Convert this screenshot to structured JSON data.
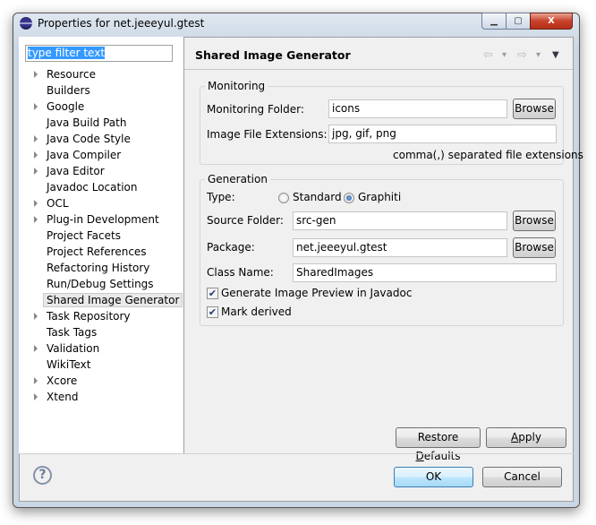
{
  "window": {
    "title": "Properties for net.jeeeyul.gtest",
    "minimize": "▁",
    "maximize": "▢",
    "close": "X"
  },
  "filter": {
    "value": "type filter text"
  },
  "tree": [
    {
      "label": "Resource",
      "expandable": true
    },
    {
      "label": "Builders",
      "expandable": false
    },
    {
      "label": "Google",
      "expandable": true
    },
    {
      "label": "Java Build Path",
      "expandable": false
    },
    {
      "label": "Java Code Style",
      "expandable": true
    },
    {
      "label": "Java Compiler",
      "expandable": true
    },
    {
      "label": "Java Editor",
      "expandable": true
    },
    {
      "label": "Javadoc Location",
      "expandable": false
    },
    {
      "label": "OCL",
      "expandable": true
    },
    {
      "label": "Plug-in Development",
      "expandable": true
    },
    {
      "label": "Project Facets",
      "expandable": false
    },
    {
      "label": "Project References",
      "expandable": false
    },
    {
      "label": "Refactoring History",
      "expandable": false
    },
    {
      "label": "Run/Debug Settings",
      "expandable": false
    },
    {
      "label": "Shared Image Generator",
      "expandable": false,
      "selected": true
    },
    {
      "label": "Task Repository",
      "expandable": true
    },
    {
      "label": "Task Tags",
      "expandable": false
    },
    {
      "label": "Validation",
      "expandable": true
    },
    {
      "label": "WikiText",
      "expandable": false
    },
    {
      "label": "Xcore",
      "expandable": true
    },
    {
      "label": "Xtend",
      "expandable": true
    }
  ],
  "page": {
    "title": "Shared Image Generator",
    "nav": {
      "back": "⇦",
      "forward": "⇨",
      "dropdown": "▾",
      "menu": "▼"
    },
    "monitoring": {
      "group": "Monitoring",
      "folder_label": "Monitoring Folder:",
      "folder_value": "icons",
      "browse": "Browse",
      "ext_label": "Image File Extensions:",
      "ext_value": "jpg, gif, png",
      "hint": "comma(,) separated file extensions"
    },
    "generation": {
      "group": "Generation",
      "type_label": "Type:",
      "type_options": [
        "Standard",
        "Graphiti"
      ],
      "type_selected": "Graphiti",
      "source_label": "Source Folder:",
      "source_value": "src-gen",
      "package_label": "Package:",
      "package_value": "net.jeeeyul.gtest",
      "class_label": "Class Name:",
      "class_value": "SharedImages",
      "browse": "Browse",
      "preview_label": "Generate Image Preview in Javadoc",
      "preview_checked": true,
      "derived_label": "Mark derived",
      "derived_checked": true
    },
    "restore_pre": "Restore ",
    "restore_mn": "D",
    "restore_post": "efaults",
    "apply_mn": "A",
    "apply_post": "pply"
  },
  "footer": {
    "help": "?",
    "ok": "OK",
    "cancel": "Cancel"
  }
}
